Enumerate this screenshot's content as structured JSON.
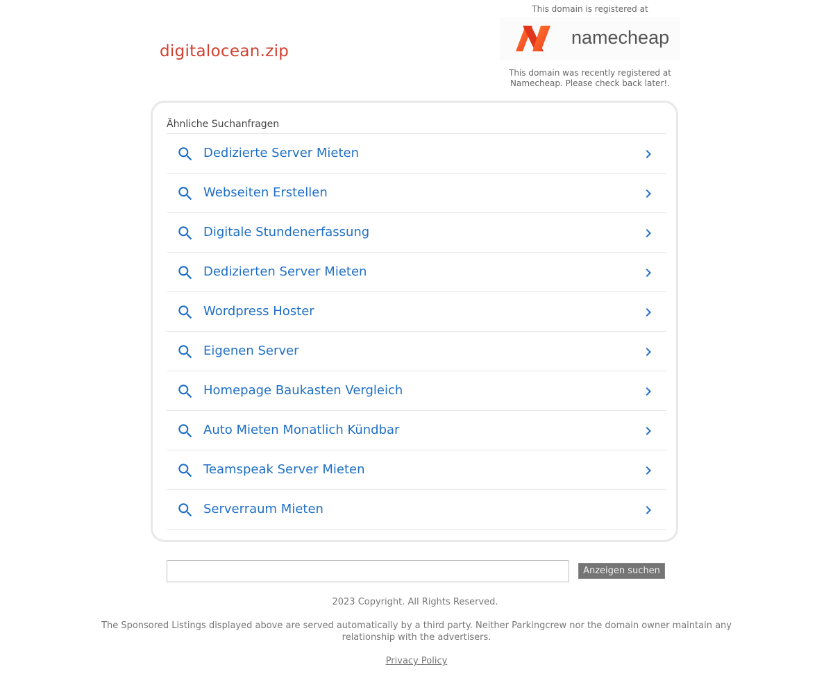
{
  "header": {
    "domain": "digitalocean.zip",
    "registrar_intro": "This domain is registered at",
    "registrar_logo_text": "namecheap",
    "registrar_note_line1": "This domain was recently registered at",
    "registrar_note_line2": "Namecheap. Please check back later!."
  },
  "related": {
    "title": "Ähnliche Suchanfragen",
    "items": [
      {
        "label": "Dedizierte Server Mieten"
      },
      {
        "label": "Webseiten Erstellen"
      },
      {
        "label": "Digitale Stundenerfassung"
      },
      {
        "label": "Dedizierten Server Mieten"
      },
      {
        "label": "Wordpress Hoster"
      },
      {
        "label": "Eigenen Server"
      },
      {
        "label": "Homepage Baukasten Vergleich"
      },
      {
        "label": "Auto Mieten Monatlich Kündbar"
      },
      {
        "label": "Teamspeak Server Mieten"
      },
      {
        "label": "Serverraum Mieten"
      }
    ],
    "icons": {
      "left": "search-icon",
      "right": "chevron-right-icon"
    }
  },
  "search": {
    "value": "",
    "button_label": "Anzeigen suchen"
  },
  "footer": {
    "copyright": "2023 Copyright. All Rights Reserved.",
    "disclaimer": "The Sponsored Listings displayed above are served automatically by a third party. Neither Parkingcrew nor the domain owner maintain any relationship with the advertisers.",
    "privacy_link": "Privacy Policy"
  },
  "colors": {
    "domain": "#d33f2f",
    "link": "#1f6fc6",
    "namecheap_orange": "#ff5a1f",
    "muted_text": "#777777",
    "button_bg": "#757575"
  }
}
